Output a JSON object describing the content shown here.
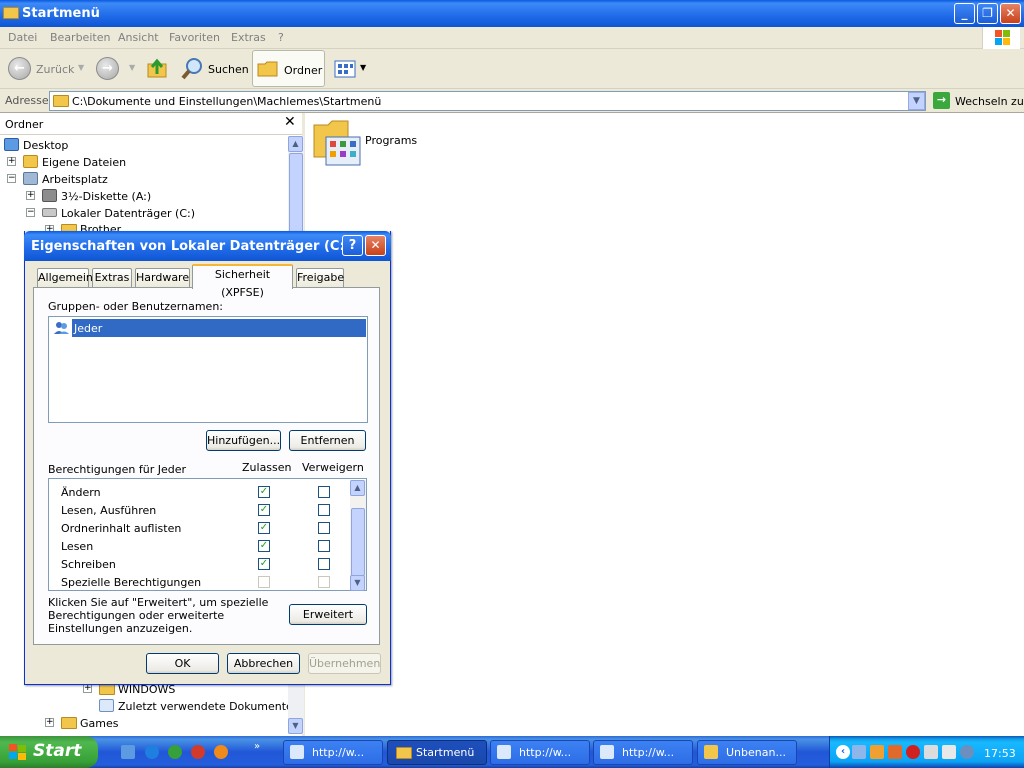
{
  "window": {
    "title": "Startmenü"
  },
  "menu": [
    "Datei",
    "Bearbeiten",
    "Ansicht",
    "Favoriten",
    "Extras",
    "?"
  ],
  "toolbar": {
    "back": "Zurück",
    "search": "Suchen",
    "folders": "Ordner"
  },
  "address": {
    "label": "Adresse",
    "path": "C:\\Dokumente und Einstellungen\\Machlemes\\Startmenü",
    "go": "Wechseln zu"
  },
  "folders_pane": {
    "title": "Ordner",
    "items": [
      "Desktop",
      "Eigene Dateien",
      "Arbeitsplatz",
      "3½-Diskette (A:)",
      "Lokaler Datenträger (C:)",
      "Brother",
      "WINDOWS",
      "Zuletzt verwendete Dokumente",
      "Games"
    ]
  },
  "content": {
    "items": [
      "Programs"
    ]
  },
  "dialog": {
    "title": "Eigenschaften von Lokaler Datenträger (C:)",
    "help": "?",
    "tabs": [
      "Allgemein",
      "Extras",
      "Hardware",
      "Sicherheit (XPFSE)",
      "Freigabe"
    ],
    "active_tab": "Sicherheit (XPFSE)",
    "groups_label": "Gruppen- oder Benutzernamen:",
    "users": [
      "Jeder"
    ],
    "add_button": "Hinzufügen...",
    "remove_button": "Entfernen",
    "perm_label": "Berechtigungen für Jeder",
    "allow_header": "Zulassen",
    "deny_header": "Verweigern",
    "permissions": [
      {
        "name": "Ändern",
        "allow": true,
        "deny": false
      },
      {
        "name": "Lesen, Ausführen",
        "allow": true,
        "deny": false
      },
      {
        "name": "Ordnerinhalt auflisten",
        "allow": true,
        "deny": false
      },
      {
        "name": "Lesen",
        "allow": true,
        "deny": false
      },
      {
        "name": "Schreiben",
        "allow": true,
        "deny": false
      },
      {
        "name": "Spezielle Berechtigungen",
        "allow": false,
        "deny": false,
        "disabled": true
      }
    ],
    "advanced_text": "Klicken Sie auf \"Erweitert\", um spezielle Berechtigungen oder erweiterte Einstellungen anzuzeigen.",
    "advanced_button": "Erweitert",
    "ok": "OK",
    "cancel": "Abbrechen",
    "apply": "Übernehmen"
  },
  "taskbar": {
    "start": "Start",
    "tasks": [
      "http://w...",
      "Startmenü",
      "http://w...",
      "http://w...",
      "Unbenan..."
    ],
    "active_task": "Startmenü",
    "clock": "17:53"
  }
}
